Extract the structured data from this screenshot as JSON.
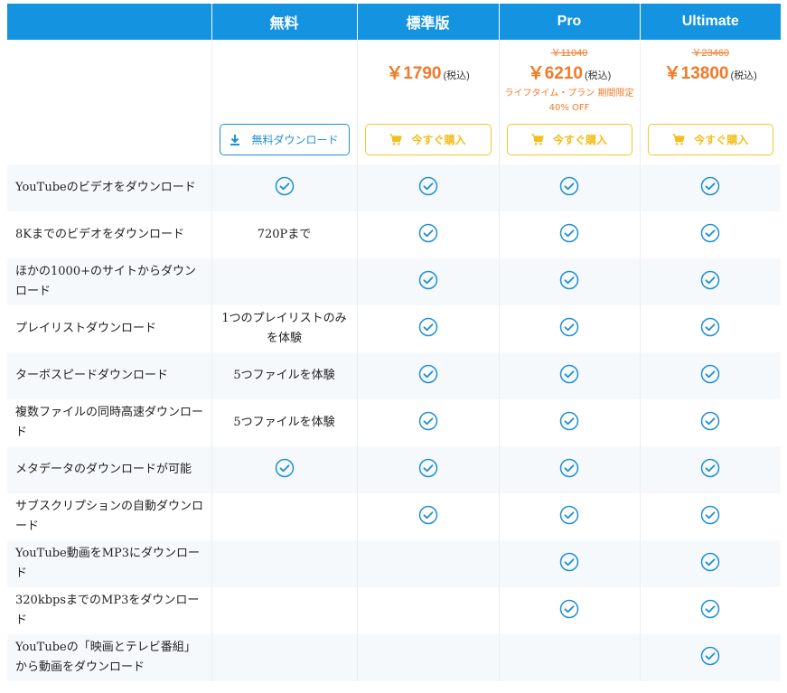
{
  "colors": {
    "header_bg": "#1393e0",
    "accent_blue": "#1f8fd6",
    "price_orange": "#f07a28",
    "buy_yellow": "#f6c72d"
  },
  "header": {
    "col1": "",
    "col2": "無料",
    "col3": "標準版",
    "col4": "Pro",
    "col5": "Ultimate"
  },
  "plans": {
    "free": {
      "button_label": "無料ダウンロード",
      "button_icon": "download-icon"
    },
    "standard": {
      "price": "￥1790",
      "tax": "(税込)",
      "button_label": "今すぐ購入",
      "button_icon": "cart-icon"
    },
    "pro": {
      "old_price": "￥11040",
      "price": "￥6210",
      "tax": "(税込)",
      "promo_line1": "ライフタイム・プラン 期間限定",
      "promo_line2": "40% OFF",
      "button_label": "今すぐ購入",
      "button_icon": "cart-icon"
    },
    "ultimate": {
      "old_price": "￥23460",
      "price": "￥13800",
      "tax": "(税込)",
      "button_label": "今すぐ購入",
      "button_icon": "cart-icon"
    }
  },
  "check_icon": "check-circle-icon",
  "features": [
    {
      "name": "YouTubeのビデオをダウンロード",
      "free": true,
      "free_text": "",
      "standard": true,
      "pro": true,
      "ultimate": true
    },
    {
      "name": "8Kまでのビデオをダウンロード",
      "free": false,
      "free_text": "720Pまで",
      "standard": true,
      "pro": true,
      "ultimate": true
    },
    {
      "name": "ほかの1000+のサイトからダウンロード",
      "free": false,
      "free_text": "",
      "standard": true,
      "pro": true,
      "ultimate": true
    },
    {
      "name": "プレイリストダウンロード",
      "free": false,
      "free_text": "1つのプレイリストのみを体験",
      "standard": true,
      "pro": true,
      "ultimate": true
    },
    {
      "name": "ターボスピードダウンロード",
      "free": false,
      "free_text": "5つファイルを体験",
      "standard": true,
      "pro": true,
      "ultimate": true
    },
    {
      "name": "複数ファイルの同時高速ダウンロード",
      "free": false,
      "free_text": "5つファイルを体験",
      "standard": true,
      "pro": true,
      "ultimate": true
    },
    {
      "name": "メタデータのダウンロードが可能",
      "free": true,
      "free_text": "",
      "standard": true,
      "pro": true,
      "ultimate": true
    },
    {
      "name": "サブスクリプションの自動ダウンロード",
      "free": false,
      "free_text": "",
      "standard": true,
      "pro": true,
      "ultimate": true
    },
    {
      "name": "YouTube動画をMP3にダウンロード",
      "free": false,
      "free_text": "",
      "standard": false,
      "pro": true,
      "ultimate": true
    },
    {
      "name": "320kbpsまでのMP3をダウンロード",
      "free": false,
      "free_text": "",
      "standard": false,
      "pro": true,
      "ultimate": true
    },
    {
      "name": "YouTubeの「映画とテレビ番組」から動画をダウンロード",
      "free": false,
      "free_text": "",
      "standard": false,
      "pro": false,
      "ultimate": true
    }
  ]
}
